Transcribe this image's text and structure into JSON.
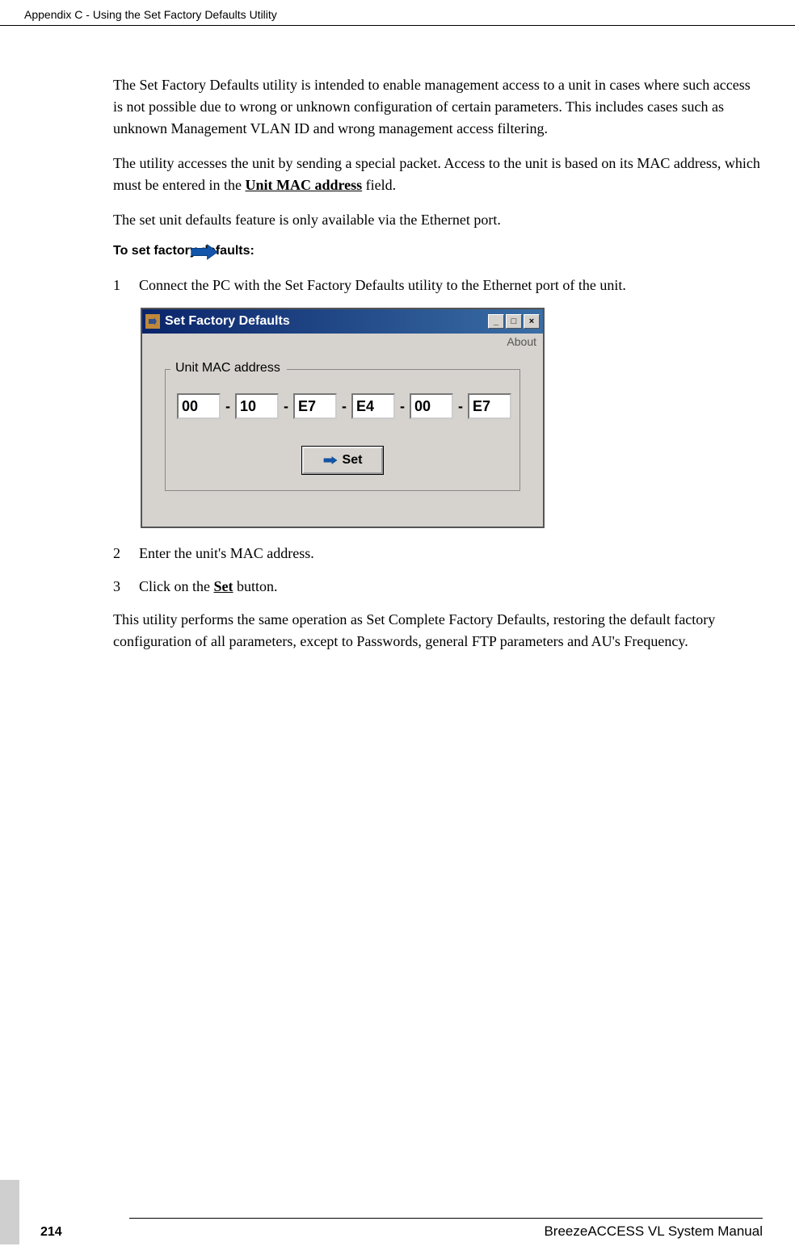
{
  "header": "Appendix C - Using the Set Factory Defaults Utility",
  "p1": "The Set Factory Defaults utility is intended to enable management access to a unit in cases where such access is not possible due to wrong or unknown configuration of certain parameters. This includes cases such as unknown Management VLAN ID and wrong management access filtering.",
  "p2a": "The utility accesses the unit by sending a special packet. Access to the unit is based on its MAC address, which must be entered in the ",
  "p2b": "Unit MAC address",
  "p2c": " field.",
  "p3": "The set unit defaults feature is only available via the Ethernet port.",
  "procHeading": "To set factory defaults:",
  "steps": {
    "s1num": "1",
    "s1": "Connect the PC with the Set Factory Defaults utility to the Ethernet port of the unit.",
    "s2num": "2",
    "s2": "Enter the unit's MAC address.",
    "s3num": "3",
    "s3a": "Click on the ",
    "s3b": "Set",
    "s3c": " button."
  },
  "p4": "This utility performs the same operation as Set Complete Factory Defaults, restoring the default factory configuration of all parameters, except to Passwords, general FTP parameters and AU's Frequency.",
  "window": {
    "title": "Set Factory Defaults",
    "menuAbout": "About",
    "groupLabel": "Unit MAC address",
    "mac": [
      "00",
      "10",
      "E7",
      "E4",
      "00",
      "E7"
    ],
    "dash": "-",
    "setLabel": "Set",
    "minLabel": "_",
    "maxLabel": "□",
    "closeLabel": "×"
  },
  "footer": {
    "page": "214",
    "manual": "BreezeACCESS VL System Manual"
  }
}
